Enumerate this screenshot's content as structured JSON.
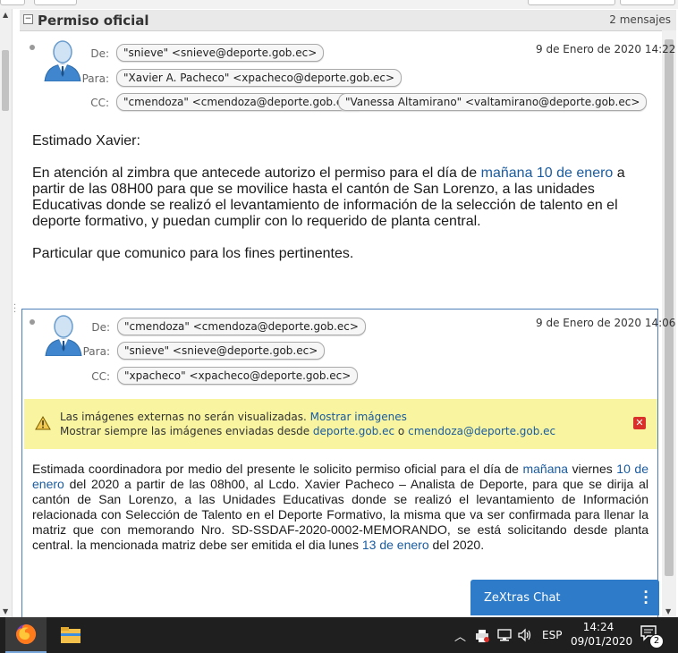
{
  "thread": {
    "title": "Permiso oficial",
    "count": "2 mensajes",
    "collapse_symbol": "⊟"
  },
  "message1": {
    "date": "9 de Enero de 2020 14:22",
    "from_label": "De:",
    "to_label": "Para:",
    "cc_label": "CC:",
    "from": "\"snieve\" <snieve@deporte.gob.ec>",
    "to": "\"Xavier A. Pacheco\" <xpacheco@deporte.gob.ec>",
    "cc": [
      "\"cmendoza\" <cmendoza@deporte.gob.ec>",
      "\"Vanessa Altamirano\" <valtamirano@deporte.gob.ec>"
    ],
    "greeting": "Estimado Xavier:",
    "p1_a": "En atención al zimbra que antecede autorizo el permiso para el día de ",
    "p1_link": "mañana 10 de enero",
    "p1_b": " a partir de las 08H00 para que se movilice hasta el cantón de San  Lorenzo, a las unidades Educativas donde se realizó el levantamiento de información de la selección de talento en el deporte formativo, y puedan cumplir con lo requerido de planta central.",
    "p2": "Particular que comunico para los fines pertinentes."
  },
  "message2": {
    "date": "9 de Enero de 2020 14:06",
    "from_label": "De:",
    "to_label": "Para:",
    "cc_label": "CC:",
    "from": "\"cmendoza\" <cmendoza@deporte.gob.ec>",
    "to": "\"snieve\" <snieve@deporte.gob.ec>",
    "cc": "\"xpacheco\" <xpacheco@deporte.gob.ec>",
    "warning": {
      "line1": "Las imágenes externas no serán visualizadas.",
      "show_link": "Mostrar imágenes",
      "line2": "Mostrar siempre las imágenes enviadas desde",
      "domain_link": "deporte.gob.ec",
      "or": "o",
      "sender_link": "cmendoza@deporte.gob.ec",
      "close": "✕"
    },
    "body_a": "Estimada coordinadora por medio del presente le solicito permiso oficial para el día de ",
    "body_link1": "mañana",
    "body_b": " viernes ",
    "body_link2": "10 de enero",
    "body_c": " del 2020 a partir de las 08h00, al Lcdo. Xavier Pacheco – Analista de Deporte, para que se dirija al cantón de San Lorenzo, a las Unidades Educativas donde se realizó el levantamiento de Información relacionada con Selección de Talento en el Deporte Formativo, la misma que va ser confirmada para llenar la matriz que con memorando Nro. SD-SSDAF-2020-0002-MEMORANDO, se está solicitando desde  planta central. la mencionada matriz debe ser emitida el dia lunes ",
    "body_link3": "13 de enero",
    "body_d": " del 2020."
  },
  "chat": {
    "label": "ZeXtras Chat",
    "menu": "⋮"
  },
  "taskbar": {
    "apps": [
      "firefox-icon",
      "file-explorer-icon"
    ],
    "tray_arrow": "^",
    "language": "ESP",
    "time": "14:24",
    "date": "09/01/2020",
    "notifications": "2"
  },
  "colors": {
    "link": "#1a5b9f",
    "chat": "#2d7bc9",
    "warning_bg": "#f8f4a0",
    "taskbar": "#1f1f1f"
  }
}
